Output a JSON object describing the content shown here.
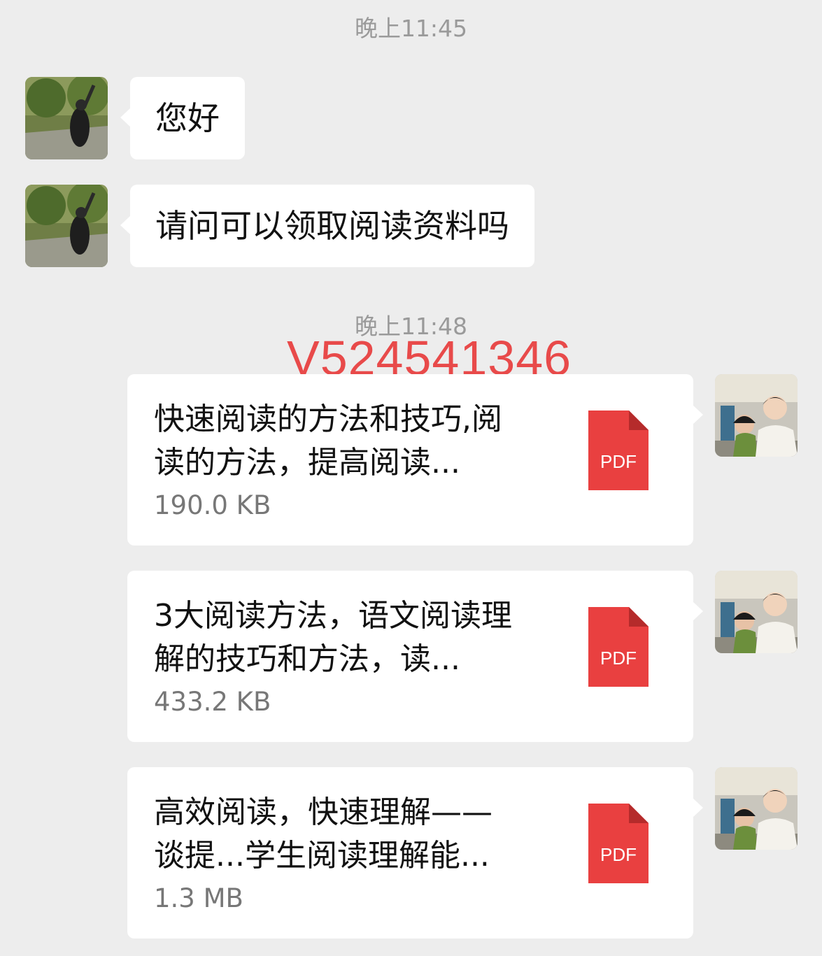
{
  "timestamps": [
    "晚上11:45",
    "晚上11:48"
  ],
  "watermark": "V524541346",
  "incoming": [
    {
      "text": "您好"
    },
    {
      "text": "请问可以领取阅读资料吗"
    }
  ],
  "files": [
    {
      "title_line1": "快速阅读的方法和技巧,阅",
      "title_line2": "读的方法，提高阅读...",
      "size": "190.0 KB",
      "type": "PDF"
    },
    {
      "title_line1": "3大阅读方法，语文阅读理",
      "title_line2": "解的技巧和方法，读...",
      "size": "433.2 KB",
      "type": "PDF"
    },
    {
      "title_line1": "高效阅读，快速理解——",
      "title_line2": "谈提...学生阅读理解能...",
      "size": "1.3 MB",
      "type": "PDF"
    }
  ],
  "colors": {
    "background": "#ededed",
    "bubble": "#ffffff",
    "pdf": "#e94040",
    "watermark": "#e84a4a"
  }
}
